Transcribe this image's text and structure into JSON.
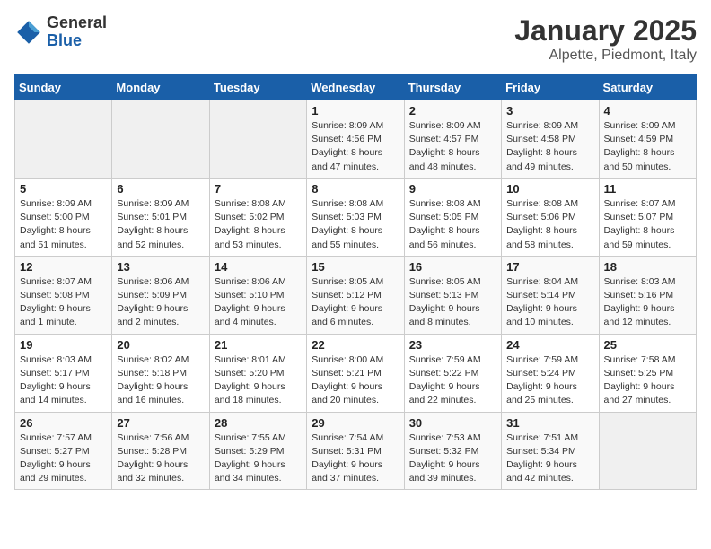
{
  "logo": {
    "general": "General",
    "blue": "Blue"
  },
  "title": "January 2025",
  "subtitle": "Alpette, Piedmont, Italy",
  "days_of_week": [
    "Sunday",
    "Monday",
    "Tuesday",
    "Wednesday",
    "Thursday",
    "Friday",
    "Saturday"
  ],
  "weeks": [
    [
      {
        "day": "",
        "info": ""
      },
      {
        "day": "",
        "info": ""
      },
      {
        "day": "",
        "info": ""
      },
      {
        "day": "1",
        "info": "Sunrise: 8:09 AM\nSunset: 4:56 PM\nDaylight: 8 hours\nand 47 minutes."
      },
      {
        "day": "2",
        "info": "Sunrise: 8:09 AM\nSunset: 4:57 PM\nDaylight: 8 hours\nand 48 minutes."
      },
      {
        "day": "3",
        "info": "Sunrise: 8:09 AM\nSunset: 4:58 PM\nDaylight: 8 hours\nand 49 minutes."
      },
      {
        "day": "4",
        "info": "Sunrise: 8:09 AM\nSunset: 4:59 PM\nDaylight: 8 hours\nand 50 minutes."
      }
    ],
    [
      {
        "day": "5",
        "info": "Sunrise: 8:09 AM\nSunset: 5:00 PM\nDaylight: 8 hours\nand 51 minutes."
      },
      {
        "day": "6",
        "info": "Sunrise: 8:09 AM\nSunset: 5:01 PM\nDaylight: 8 hours\nand 52 minutes."
      },
      {
        "day": "7",
        "info": "Sunrise: 8:08 AM\nSunset: 5:02 PM\nDaylight: 8 hours\nand 53 minutes."
      },
      {
        "day": "8",
        "info": "Sunrise: 8:08 AM\nSunset: 5:03 PM\nDaylight: 8 hours\nand 55 minutes."
      },
      {
        "day": "9",
        "info": "Sunrise: 8:08 AM\nSunset: 5:05 PM\nDaylight: 8 hours\nand 56 minutes."
      },
      {
        "day": "10",
        "info": "Sunrise: 8:08 AM\nSunset: 5:06 PM\nDaylight: 8 hours\nand 58 minutes."
      },
      {
        "day": "11",
        "info": "Sunrise: 8:07 AM\nSunset: 5:07 PM\nDaylight: 8 hours\nand 59 minutes."
      }
    ],
    [
      {
        "day": "12",
        "info": "Sunrise: 8:07 AM\nSunset: 5:08 PM\nDaylight: 9 hours\nand 1 minute."
      },
      {
        "day": "13",
        "info": "Sunrise: 8:06 AM\nSunset: 5:09 PM\nDaylight: 9 hours\nand 2 minutes."
      },
      {
        "day": "14",
        "info": "Sunrise: 8:06 AM\nSunset: 5:10 PM\nDaylight: 9 hours\nand 4 minutes."
      },
      {
        "day": "15",
        "info": "Sunrise: 8:05 AM\nSunset: 5:12 PM\nDaylight: 9 hours\nand 6 minutes."
      },
      {
        "day": "16",
        "info": "Sunrise: 8:05 AM\nSunset: 5:13 PM\nDaylight: 9 hours\nand 8 minutes."
      },
      {
        "day": "17",
        "info": "Sunrise: 8:04 AM\nSunset: 5:14 PM\nDaylight: 9 hours\nand 10 minutes."
      },
      {
        "day": "18",
        "info": "Sunrise: 8:03 AM\nSunset: 5:16 PM\nDaylight: 9 hours\nand 12 minutes."
      }
    ],
    [
      {
        "day": "19",
        "info": "Sunrise: 8:03 AM\nSunset: 5:17 PM\nDaylight: 9 hours\nand 14 minutes."
      },
      {
        "day": "20",
        "info": "Sunrise: 8:02 AM\nSunset: 5:18 PM\nDaylight: 9 hours\nand 16 minutes."
      },
      {
        "day": "21",
        "info": "Sunrise: 8:01 AM\nSunset: 5:20 PM\nDaylight: 9 hours\nand 18 minutes."
      },
      {
        "day": "22",
        "info": "Sunrise: 8:00 AM\nSunset: 5:21 PM\nDaylight: 9 hours\nand 20 minutes."
      },
      {
        "day": "23",
        "info": "Sunrise: 7:59 AM\nSunset: 5:22 PM\nDaylight: 9 hours\nand 22 minutes."
      },
      {
        "day": "24",
        "info": "Sunrise: 7:59 AM\nSunset: 5:24 PM\nDaylight: 9 hours\nand 25 minutes."
      },
      {
        "day": "25",
        "info": "Sunrise: 7:58 AM\nSunset: 5:25 PM\nDaylight: 9 hours\nand 27 minutes."
      }
    ],
    [
      {
        "day": "26",
        "info": "Sunrise: 7:57 AM\nSunset: 5:27 PM\nDaylight: 9 hours\nand 29 minutes."
      },
      {
        "day": "27",
        "info": "Sunrise: 7:56 AM\nSunset: 5:28 PM\nDaylight: 9 hours\nand 32 minutes."
      },
      {
        "day": "28",
        "info": "Sunrise: 7:55 AM\nSunset: 5:29 PM\nDaylight: 9 hours\nand 34 minutes."
      },
      {
        "day": "29",
        "info": "Sunrise: 7:54 AM\nSunset: 5:31 PM\nDaylight: 9 hours\nand 37 minutes."
      },
      {
        "day": "30",
        "info": "Sunrise: 7:53 AM\nSunset: 5:32 PM\nDaylight: 9 hours\nand 39 minutes."
      },
      {
        "day": "31",
        "info": "Sunrise: 7:51 AM\nSunset: 5:34 PM\nDaylight: 9 hours\nand 42 minutes."
      },
      {
        "day": "",
        "info": ""
      }
    ]
  ]
}
